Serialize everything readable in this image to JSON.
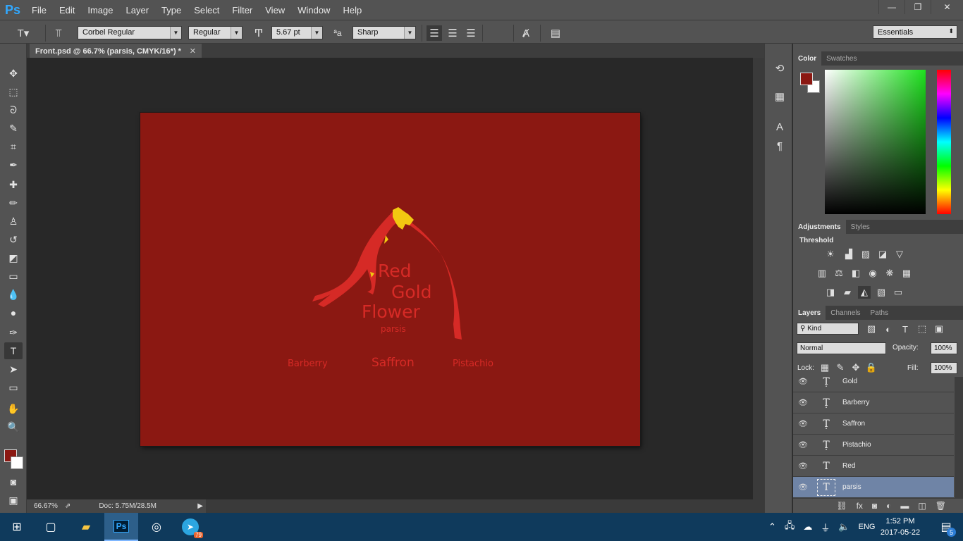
{
  "app": {
    "logo": "Ps"
  },
  "menu": [
    "File",
    "Edit",
    "Image",
    "Layer",
    "Type",
    "Select",
    "Filter",
    "View",
    "Window",
    "Help"
  ],
  "window_controls": {
    "minimize": "—",
    "restore": "❐",
    "close": "✕"
  },
  "options": {
    "font_family": "Corbel Regular",
    "font_style": "Regular",
    "font_size": "5.67 pt",
    "aa_label": "ªa",
    "anti_alias": "Sharp",
    "text_color": "#e8231e",
    "workspace": "Essentials"
  },
  "document": {
    "tab_title": "Front.psd @ 66.7% (parsis, CMYK/16*) *",
    "zoom": "66.67%",
    "doc_size": "Doc: 5.75M/28.5M",
    "background_color": "#8b1812"
  },
  "artwork": {
    "line1": "Red",
    "line2": "Gold",
    "line3": "Flower",
    "subtitle": "parsis",
    "left_label": "Barberry",
    "center_label": "Saffron",
    "right_label": "Pistachio"
  },
  "panels": {
    "color_tabs": [
      "Color",
      "Swatches"
    ],
    "foreground": "#8b1812",
    "background": "#ffffff",
    "adjust_tabs": [
      "Adjustments",
      "Styles"
    ],
    "adjust_hover": "Threshold",
    "layer_tabs": [
      "Layers",
      "Channels",
      "Paths"
    ],
    "filter_kind": "Kind",
    "blend_mode": "Normal",
    "opacity_label": "Opacity:",
    "opacity": "100%",
    "lock_label": "Lock:",
    "fill_label": "Fill:",
    "fill": "100%",
    "layers": [
      {
        "name": "Gold",
        "type": "text-warp"
      },
      {
        "name": "Barberry",
        "type": "text-warp"
      },
      {
        "name": "Saffron",
        "type": "text-warp"
      },
      {
        "name": "Pistachio",
        "type": "text-warp"
      },
      {
        "name": "Red",
        "type": "text"
      },
      {
        "name": "parsis",
        "type": "text",
        "selected": true
      }
    ]
  },
  "taskbar": {
    "time": "1:52 PM",
    "date": "2017-05-22",
    "language": "ENG",
    "telegram_badge": "79",
    "notifications": "5"
  }
}
